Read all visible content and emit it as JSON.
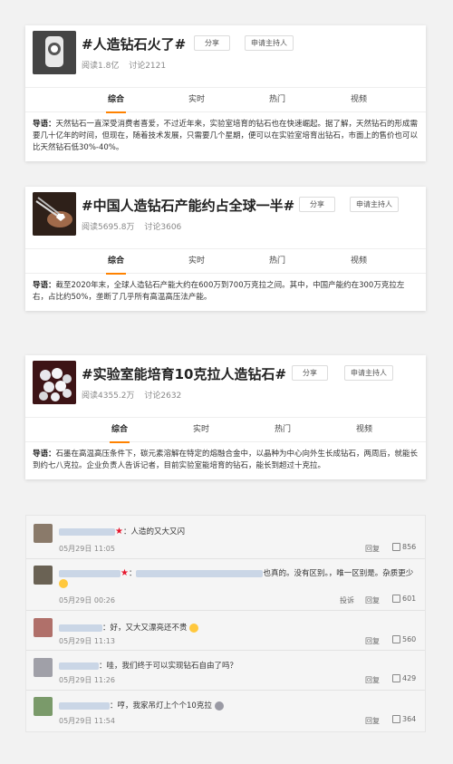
{
  "topics": [
    {
      "title": "#人造钻石火了#",
      "share": "分享",
      "apply": "申请主持人",
      "reads": "阅读1.8亿",
      "discuss": "讨论2121",
      "tabs": [
        "综合",
        "实时",
        "热门",
        "视频"
      ],
      "guide_label": "导语：",
      "guide_text": "天然钻石一直深受消费者喜爱，不过近年来，实验室培育的钻石也在快速崛起。据了解，天然钻石的形成需要几十亿年的时间，但现在，随着技术发展，只需要几个星期，便可以在实验室培育出钻石，市面上的售价也可以比天然钻石低30%-40%。"
    },
    {
      "title": "#中国人造钻石产能约占全球一半#",
      "share": "分享",
      "apply": "申请主持人",
      "reads": "阅读5695.8万",
      "discuss": "讨论3606",
      "tabs": [
        "综合",
        "实时",
        "热门",
        "视频"
      ],
      "guide_label": "导语：",
      "guide_text": "截至2020年末，全球人造钻石产能大约在600万到700万克拉之间。其中，中国产能约在300万克拉左右，占比约50%，垄断了几乎所有高温高压法产能。"
    },
    {
      "title": "#实验室能培育10克拉人造钻石#",
      "share": "分享",
      "apply": "申请主持人",
      "reads": "阅读4355.2万",
      "discuss": "讨论2632",
      "tabs": [
        "综合",
        "实时",
        "热门",
        "视频"
      ],
      "guide_label": "导语：",
      "guide_text": "石墨在高温高压条件下，碳元素溶解在特定的熔融合金中，以晶种为中心向外生长成钻石，两周后，就能长到约七八克拉。企业负责人告诉记者，目前实验室能培育的钻石，能长到超过十克拉。"
    }
  ],
  "comments": [
    {
      "text": "人造的又大又闪",
      "time": "05月29日 11:05",
      "reply": "回复",
      "likes": "856",
      "report": ""
    },
    {
      "text": "也真的。没有区别。，唯一区别是。杂质更少",
      "time": "05月29日 00:26",
      "reply": "回复",
      "likes": "601",
      "report": "投诉"
    },
    {
      "text": "：好，又大又漂亮还不贵",
      "time": "05月29日 11:13",
      "reply": "回复",
      "likes": "560",
      "report": ""
    },
    {
      "text": "：哇，我们终于可以实现钻石自由了吗？",
      "time": "05月29日 11:26",
      "reply": "回复",
      "likes": "429",
      "report": ""
    },
    {
      "text": "：哼，我家吊灯上个个10克拉",
      "time": "05月29日 11:54",
      "reply": "回复",
      "likes": "364",
      "report": ""
    }
  ],
  "colors": {
    "accent": "#ff8200",
    "star": "#e6162d"
  }
}
